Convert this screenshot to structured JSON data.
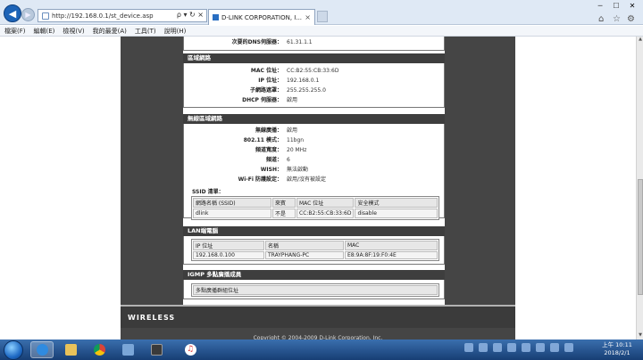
{
  "browser": {
    "url": "http://192.168.0.1/st_device.asp",
    "tab_title": "D-LINK CORPORATION, I...",
    "menu": [
      "檔案(F)",
      "編輯(E)",
      "檢視(V)",
      "我的最愛(A)",
      "工具(T)",
      "說明(H)"
    ],
    "address_tools": "ρ ▾ ↻ ×"
  },
  "page": {
    "top_partial": {
      "label": "次要的DNS伺服器：",
      "value": "61.31.1.1"
    },
    "lan": {
      "title": "區域網路",
      "rows": [
        {
          "label": "MAC 位址：",
          "value": "CC:B2:55:CB:33:6D"
        },
        {
          "label": "IP 位址：",
          "value": "192.168.0.1"
        },
        {
          "label": "子網路遮罩：",
          "value": "255.255.255.0"
        },
        {
          "label": "DHCP 伺服器：",
          "value": "啟用"
        }
      ]
    },
    "wlan": {
      "title": "無線區域網路",
      "rows": [
        {
          "label": "無線廣播：",
          "value": "啟用"
        },
        {
          "label": "802.11 模式：",
          "value": "11bgn"
        },
        {
          "label": "頻道寬度：",
          "value": "20 MHz"
        },
        {
          "label": "頻道：",
          "value": "6"
        },
        {
          "label": "WISH：",
          "value": "無法啟動"
        },
        {
          "label": "Wi-Fi 防護設定：",
          "value": "啟用/沒有被設定"
        }
      ],
      "ssid_list_label": "SSID 清單：",
      "ssid_table": {
        "headers": [
          "網路名稱 (SSID)",
          "來賓",
          "MAC 位址",
          "安全模式"
        ],
        "row": [
          "dlink",
          "不是",
          "CC:B2:55:CB:33:6D",
          "disable"
        ]
      }
    },
    "lan_computers": {
      "title": "LAN端電腦",
      "headers": [
        "IP 位址",
        "名稱",
        "MAC"
      ],
      "row": [
        "192.168.0.100",
        "TRAYPHANG-PC",
        "E8:9A:8F:19:F0:4E"
      ]
    },
    "igmp": {
      "title": "IGMP 多點廣播成員",
      "header": "多點廣播群組位址"
    },
    "footer_logo": "WIRELESS",
    "copyright": "Copyright © 2004-2009 D-Link Corporation, Inc."
  },
  "taskbar": {
    "time": "上午 10:11",
    "date": "2018/2/1"
  }
}
